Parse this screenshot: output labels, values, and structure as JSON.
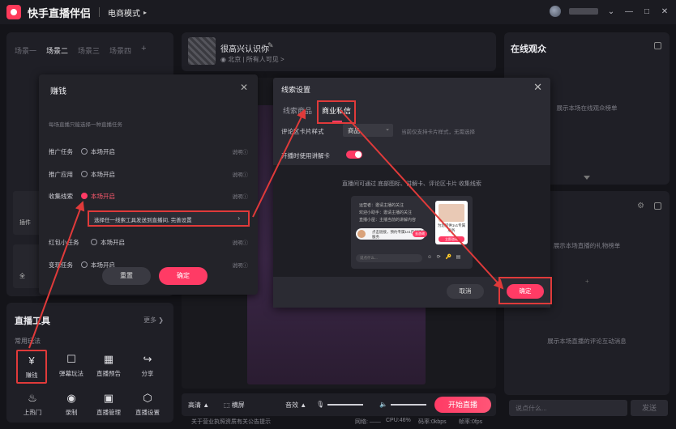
{
  "app": {
    "title": "快手直播伴侣",
    "mode": "电商模式",
    "mode_caret": "▸",
    "window_buttons": [
      "⌄",
      "—",
      "□",
      "✕"
    ]
  },
  "scenes": {
    "tabs": [
      "场景一",
      "场景二",
      "场景三",
      "场景四"
    ],
    "active_index": 1,
    "add": "+"
  },
  "stream": {
    "title": "很高兴认识你",
    "location": "北京",
    "visibility": "所有人可见 >"
  },
  "online": {
    "title": "在线观众",
    "desc": "展示本场在线观众榜单"
  },
  "gift": {
    "desc": "展示本场直播的礼物榜单",
    "comment_desc": "展示本场直播的评论互动消息",
    "plus": "+"
  },
  "comment": {
    "placeholder": "说点什么...",
    "send": "发送"
  },
  "tools": {
    "title": "直播工具",
    "more": "更多 ❯",
    "subtitle": "常用玩法",
    "items": [
      {
        "label": "赚钱",
        "icon": "¥"
      },
      {
        "label": "弹幕玩法",
        "icon": "☐"
      },
      {
        "label": "直播预告",
        "icon": "▦"
      },
      {
        "label": "分享",
        "icon": "↪"
      },
      {
        "label": "上热门",
        "icon": "♨"
      },
      {
        "label": "录制",
        "icon": "◉"
      },
      {
        "label": "直播管理",
        "icon": "▣"
      },
      {
        "label": "直播设置",
        "icon": "⬡"
      }
    ]
  },
  "side_fragments": [
    "插件",
    "全"
  ],
  "bottom_bar": {
    "quality": "高清 ▲",
    "landscape": "横屏",
    "volume_label": "音效 ▲",
    "start": "开始直播"
  },
  "status": {
    "notice": "关于营业执照资质有关公告提示",
    "network": "网络: ——",
    "cpu": "CPU:46%",
    "bitrate": "码率:0kbps",
    "fps": "帧率:0fps"
  },
  "earn_modal": {
    "title": "赚钱",
    "close": "✕",
    "hint": "每场直播只能选择一种直播任务",
    "rows": [
      {
        "name": "推广任务",
        "state": "本场开启",
        "detail": "说明ⓘ",
        "on": false
      },
      {
        "name": "推广应用",
        "state": "本场开启",
        "detail": "说明ⓘ",
        "on": false
      },
      {
        "name": "收集线索",
        "state": "本场开启",
        "detail": "说明ⓘ",
        "on": true
      },
      {
        "name": "红包小任务",
        "state": "本场开启",
        "detail": "说明ⓘ",
        "on": false
      },
      {
        "name": "变现任务",
        "state": "本场开启",
        "detail": "说明ⓘ",
        "on": false
      }
    ],
    "select_text": "选择任一线索工具发送到直播间, 完善设置",
    "select_arrow": "›",
    "reset": "重置",
    "ok": "确定"
  },
  "lead_modal": {
    "title": "线索设置",
    "close": "✕",
    "tabs": [
      "线索商品",
      "商业私信"
    ],
    "card_style_label": "评论区卡片样式",
    "card_style_value": "商品",
    "card_style_hint": "当前仅支持卡片样式，无需选择",
    "toggle_label": "开播时使用讲解卡",
    "toggle_on": true,
    "desc": "直播间可通过 底部图标、讲解卡、评论区卡片 收集线索",
    "demo": {
      "line1": "运营者：邀请主播的关注",
      "line2": "欢迎小助手：邀请主播的关注",
      "line3": "直播小屋：主播当前的讲解内容",
      "bubble": "点击链接，预约专属1v1在线咨询服务",
      "pill": "去咨询",
      "product": "为您提供1v1专属服务",
      "product_btn": "立即咨询",
      "input": "说点什么...",
      "icons": "☺ ⟳ 🔑 ▤"
    },
    "cancel": "取消",
    "confirm": "确定"
  },
  "colors": {
    "accent": "#ff3b65",
    "annotation": "#e03a3a",
    "panel": "#1f1f26",
    "background": "#141419"
  }
}
